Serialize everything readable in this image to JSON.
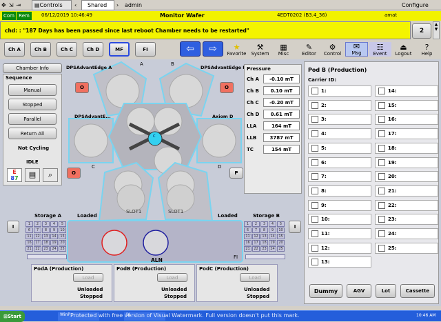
{
  "topbar": {
    "controls": "Controls",
    "tab": "Shared",
    "user": "admin",
    "configure": "Configure"
  },
  "status": {
    "com": "Com",
    "rem": "Rem",
    "datetime": "06/12/2019 10:46:49",
    "title": "Monitor Wafer",
    "tool": "4EDT0202 (B3.4_36)",
    "user": "amat"
  },
  "alarm": {
    "message": "chd: : \"187 Days has been passed since last reboot Chamber needs to be restarted\"",
    "count": "2"
  },
  "chambers": [
    "Ch A",
    "Ch B",
    "Ch C",
    "Ch D",
    "MF",
    "FI"
  ],
  "nav": [
    "Favorite",
    "System",
    "Misc",
    "Editor",
    "Control",
    "Msg",
    "Event",
    "Logout",
    "Help"
  ],
  "left": {
    "chamber_info": "Chamber Info",
    "sequence": "Sequence",
    "manual": "Manual",
    "stopped": "Stopped",
    "parallel": "Parallel",
    "return_all": "Return All",
    "not_cycling": "Not Cycling",
    "idle": "IDLE"
  },
  "chamber_labels": {
    "a": "DPSAdvantEdge A",
    "b": "DPSAdvantEdge B",
    "c": "DPSAdvantE...",
    "d": "Axiom D",
    "la": "A",
    "lb": "B",
    "lc": "C",
    "ld": "D",
    "o": "O",
    "p": "P",
    "slot1": "SLOT1",
    "slot2": "SLOT1",
    "cl": "C\nL"
  },
  "pressure": {
    "title": "Pressure",
    "rows": [
      {
        "label": "Ch A",
        "value": "-0.10 mT"
      },
      {
        "label": "Ch B",
        "value": "0.10 mT"
      },
      {
        "label": "Ch C",
        "value": "-0.20 mT"
      },
      {
        "label": "Ch D",
        "value": "0.61 mT"
      },
      {
        "label": "LLA",
        "value": "164 mT"
      },
      {
        "label": "LLB",
        "value": "3787 mT"
      },
      {
        "label": "TC",
        "value": "154 mT"
      }
    ]
  },
  "pod_b": {
    "title": "Pod B (Production)",
    "carrier": "Carrier ID:",
    "slots": [
      "1:",
      "2:",
      "3:",
      "4:",
      "5:",
      "6:",
      "7:",
      "8:",
      "9:",
      "10:",
      "11:",
      "12:",
      "13:",
      "14:",
      "15:",
      "16:",
      "17:",
      "18:",
      "19:",
      "20:",
      "21:",
      "22:",
      "23:",
      "24:",
      "25:"
    ]
  },
  "storage": {
    "a": "Storage A",
    "b": "Storage B",
    "loaded_left": "Loaded",
    "loaded_right": "Loaded",
    "i_left": "I",
    "i_right": "I",
    "aln": "ALN",
    "fi": "FI"
  },
  "storage_grid": [
    "1",
    "2",
    "3",
    "4",
    "5",
    "6",
    "7",
    "8",
    "9",
    "10",
    "11",
    "12",
    "13",
    "14",
    "15",
    "16",
    "17",
    "18",
    "19",
    "20",
    "21",
    "22",
    "23",
    "24",
    "25"
  ],
  "pods": [
    {
      "title": "PodA (Production)",
      "btn": "Load",
      "state1": "Unloaded",
      "state2": "Stopped"
    },
    {
      "title": "PodB (Production)",
      "btn": "Load",
      "state1": "Unloaded",
      "state2": "Stopped"
    },
    {
      "title": "PodC (Production)",
      "btn": "Load",
      "state1": "Unloaded",
      "state2": "Stopped"
    }
  ],
  "bottom_buttons": [
    "Dummy",
    "AGV",
    "Lot",
    "Cassette"
  ],
  "taskbar": {
    "start": "Start",
    "item1": "WinP",
    "item2": "IX",
    "watermark": "Protected with free version of Visual Watermark. Full version doesn't put this mark.",
    "time": "10:46 AM"
  }
}
